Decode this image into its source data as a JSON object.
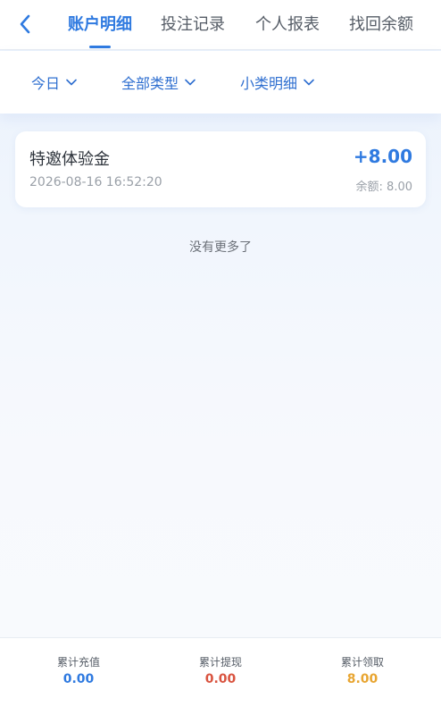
{
  "nav": {
    "tabs": [
      {
        "label": "账户明细",
        "active": true
      },
      {
        "label": "投注记录",
        "active": false
      },
      {
        "label": "个人报表",
        "active": false
      },
      {
        "label": "找回余额",
        "active": false
      }
    ],
    "back_icon": "chevron-left-icon"
  },
  "filters": [
    {
      "label": "今日",
      "icon": "chevron-down-icon"
    },
    {
      "label": "全部类型",
      "icon": "chevron-down-icon"
    },
    {
      "label": "小类明细",
      "icon": "chevron-down-icon"
    }
  ],
  "records": [
    {
      "title": "特邀体验金",
      "time": "2026-08-16 16:52:20",
      "amount": "+8.00",
      "balance": "余额: 8.00"
    }
  ],
  "list_end_text": "没有更多了",
  "summary": [
    {
      "label": "累计充值",
      "value": "0.00",
      "color": "#2f7ae0"
    },
    {
      "label": "累计提现",
      "value": "0.00",
      "color": "#d9533f"
    },
    {
      "label": "累计领取",
      "value": "8.00",
      "color": "#e8a531"
    }
  ],
  "colors": {
    "accent": "#2f7ae0"
  }
}
